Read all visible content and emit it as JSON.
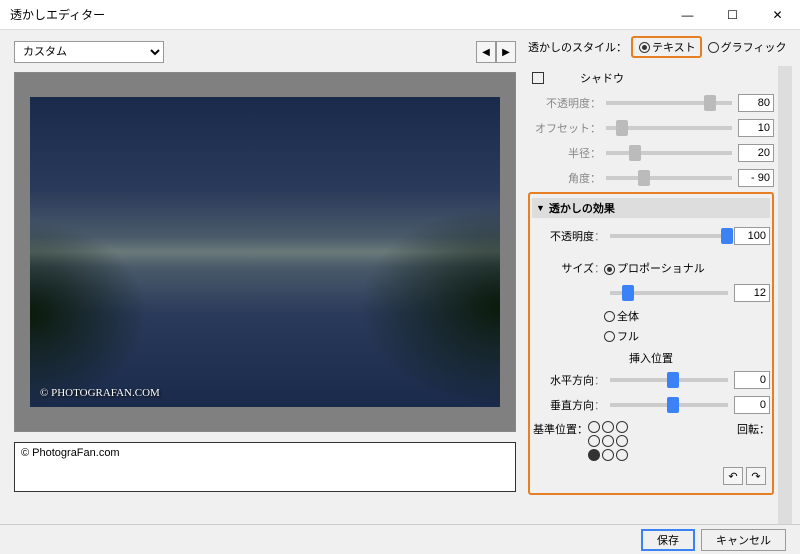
{
  "window": {
    "title": "透かしエディター"
  },
  "preset": {
    "value": "カスタム"
  },
  "preview": {
    "watermark_text": "© PHOTOGRAFAN.COM"
  },
  "text_input": {
    "value": "© PhotograFan.com"
  },
  "style": {
    "label": "透かしのスタイル：",
    "text_option": "テキスト",
    "graphic_option": "グラフィック"
  },
  "shadow": {
    "title": "シャドウ",
    "opacity_label": "不透明度",
    "opacity_value": "80",
    "offset_label": "オフセット",
    "offset_value": "10",
    "radius_label": "半径",
    "radius_value": "20",
    "angle_label": "角度",
    "angle_value": "- 90"
  },
  "effects": {
    "title": "透かしの効果",
    "opacity_label": "不透明度",
    "opacity_value": "100",
    "size_label": "サイズ",
    "proportional": "プロポーショナル",
    "size_value": "12",
    "fit": "全体",
    "fill": "フル",
    "position_title": "挿入位置",
    "horizontal_label": "水平方向",
    "horizontal_value": "0",
    "vertical_label": "垂直方向",
    "vertical_value": "0",
    "anchor_label": "基準位置：",
    "rotate_label": "回転："
  },
  "footer": {
    "save": "保存",
    "cancel": "キャンセル"
  }
}
